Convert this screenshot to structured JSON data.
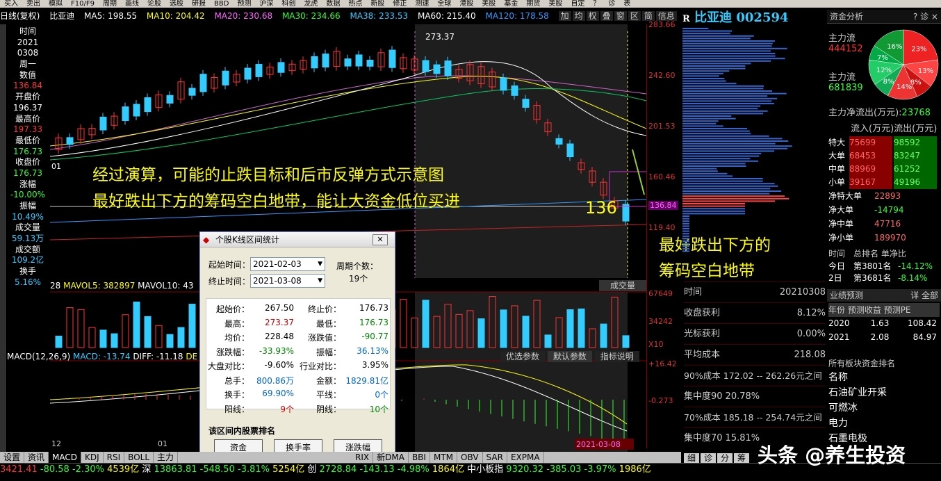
{
  "menu": [
    "买入",
    "卖出",
    "模拟",
    "F10/F9",
    "周期",
    "画线",
    "论股",
    "选股",
    "研报",
    "BBD",
    "预测",
    "沪深",
    "科创",
    "龙虎",
    "数据",
    "热点",
    "新股",
    "修正",
    "测速",
    "全球",
    "港股",
    "美股",
    "基金",
    "期货",
    "美股",
    "自定",
    "？",
    "诊",
    "表"
  ],
  "header": {
    "period": "日线(复权)",
    "name": "比亚迪",
    "ma5": "MA5: 198.55",
    "ma10": "MA10: 204.42",
    "ma20": "MA20: 230.68",
    "ma30": "MA30: 234.66",
    "ma38": "MA38: 233.53",
    "ma60": "MA60: 215.40",
    "ma120": "MA120: 178.58",
    "buttons": [
      "加",
      "均",
      "权",
      "叠",
      "窗",
      "区",
      "简",
      "信息"
    ]
  },
  "info": {
    "l1": "时间",
    "l2": "2021",
    "l3": "0308",
    "l4": "周一",
    "l5": "数值",
    "v5": "136.84",
    "l6": "开盘价",
    "v6": "196.37",
    "l7": "最高价",
    "v7": "197.33",
    "l8": "最低价",
    "v8": "176.73",
    "l9": "收盘价",
    "v9": "176.73",
    "l10": "涨幅",
    "v10": "-10.00%",
    "l11": "振幅",
    "v11": "10.49%",
    "l12": "成交量",
    "v12": "59.13万",
    "l13": "成交额",
    "v13": "109.2亿",
    "l14": "换手",
    "v14": "5.16%"
  },
  "axis": {
    "p1": "283.66",
    "p2": "242.60",
    "p3": "201.53",
    "p4": "160.46",
    "p5": "136.84",
    "p6": "119.40",
    "v1": "67649",
    "v2": "34242",
    "v3": "X10",
    "m1": "+16.42",
    "m2": "-0.273"
  },
  "chart": {
    "high_label": "273.37",
    "low_marker": "136",
    "x_label1": "01",
    "x_label2": "12",
    "x_label3": "01",
    "date_marker": "2021-03-08"
  },
  "volume": {
    "mavol5": "MAVOL5: 382897",
    "mavol10": "MAVOL10: 43",
    "label": "成交量",
    "v28": "28"
  },
  "macd": {
    "title": "MACD(12,26,9)",
    "macd": "MACD: -13.74",
    "diff": "DIFF: -11.18",
    "dea": "DE",
    "btn1": "优选参数",
    "btn2": "默认参数",
    "btn3": "指标说明"
  },
  "annot": {
    "t1": "经过演算，可能的止跌目标和后市反弹方式示意图",
    "t2": "最好跌出下方的筹码空白地带，能让大资金低位买进",
    "t3": "最好跌出下方的",
    "t4": "筹码空白地带"
  },
  "stock": {
    "name": "比亚迪",
    "code": "002594",
    "r": "R"
  },
  "cost": {
    "r1l": "时间",
    "r1v": "20210308",
    "r2l": "收盘获利",
    "r2v": "8.12%",
    "r3l": "光标获利",
    "r3v": "0.00%",
    "r4l": "平均成本",
    "r4v": "218.08",
    "r5": "90%成本 172.02 -- 262.26元之间",
    "r6l": "集中度90",
    "r6v": "20.78%",
    "r7": "70%成本 185.18 -- 254.74元之间",
    "r8l": "集中度70",
    "r8v": "15.81%"
  },
  "right": {
    "title": "资金分析",
    "icons": "? 诊 ×",
    "zl1": "主力流",
    "zl1v": "444152",
    "zl2": "主力流",
    "zl2v": "681839",
    "net": "主力净流出(万元)",
    "netv": "23768",
    "pie": [
      "23%",
      "13%",
      "8%",
      "14%",
      "8%",
      "12%",
      "7%",
      "16%"
    ],
    "flow_head": [
      "流入(万元)",
      "流出(万元)"
    ],
    "flows": [
      {
        "l": "特大",
        "in": "75699",
        "out": "98592"
      },
      {
        "l": "大单",
        "in": "68453",
        "out": "83247"
      },
      {
        "l": "中单",
        "in": "88969",
        "out": "61252"
      },
      {
        "l": "小单",
        "in": "39167",
        "out": "49196"
      }
    ],
    "nets": [
      {
        "l": "净特大单",
        "v": "22893"
      },
      {
        "l": "净大单",
        "v": "-14794"
      },
      {
        "l": "净中单",
        "v": "47716"
      },
      {
        "l": "净小单",
        "v": "189970"
      }
    ],
    "rank_head": [
      "时间",
      "总排名",
      "单净比"
    ],
    "rank": [
      {
        "t": "今日",
        "r": "第3801名",
        "p": "-14.12%"
      },
      {
        "t": "2日",
        "r": "第3681名",
        "p": "-8.14%"
      }
    ],
    "perf_title": "业绩预测",
    "perf_btns": "详 全部",
    "perf_head": [
      "年份",
      "预测收益",
      "预测PE"
    ],
    "perf": [
      {
        "y": "2020",
        "e": "1.63",
        "pe": "108.42"
      },
      {
        "y": "2021",
        "e": "2.08",
        "pe": "84.97"
      }
    ],
    "sector_title": "所有板块资金排名",
    "sector_head": "名称",
    "sectors": [
      "石油矿业开采",
      "可燃冰",
      "电力",
      "石墨电极"
    ]
  },
  "dialog": {
    "title": "个股K线区间统计",
    "start_l": "起始时间：",
    "start": "2021-02-03",
    "end_l": "终止时间：",
    "end": "2021-03-08",
    "period_l": "周期个数：",
    "period": "19个",
    "stats": [
      [
        "起始价：",
        "267.50",
        "终止价：",
        "176.73"
      ],
      [
        "最高：",
        "273.37",
        "最低：",
        "176.73"
      ],
      [
        "均价：",
        "228.48",
        "涨跌值：",
        "-90.77"
      ],
      [
        "涨跌幅：",
        "-33.93%",
        "振幅：",
        "36.13%"
      ],
      [
        "大盘对比：",
        "-9.60%",
        "行业对比：",
        "3.95%"
      ],
      [
        "总手：",
        "800.86万",
        "金额：",
        "1829.81亿"
      ],
      [
        "换手：",
        "69.90%",
        "平线：",
        "0个"
      ],
      [
        "阳线：",
        "9个",
        "阴线：",
        "10个"
      ]
    ],
    "rank_l": "该区间内股票排名",
    "b1": "资金",
    "b2": "换手率",
    "b3": "涨跌幅"
  },
  "tabs": [
    "设置",
    "资讯",
    "MACD",
    "KDJ",
    "RSI",
    "BOLL",
    "主力",
    "RIX",
    "新DMA",
    "BBI",
    "MTM",
    "OBV",
    "SAR",
    "EXPMA"
  ],
  "bottom_tabs": [
    "细",
    "诊",
    "分",
    "筹"
  ],
  "ticker": {
    "a": "3421.41",
    "b": "-80.58",
    "c": "-2.30%",
    "d": "4539亿",
    "e": "深",
    "f": "13863.81",
    "g": "-548.50",
    "h": "-3.81%",
    "i": "5254亿",
    "j": "创",
    "k": "2728.84",
    "l": "-143.13",
    "m": "-4.98%",
    "n": "1864亿",
    "o": "中小板指",
    "p": "9320.32",
    "q": "-385.03",
    "r": "-3.97%",
    "s": "1986亿"
  },
  "watermark": "头条 @养生投资"
}
